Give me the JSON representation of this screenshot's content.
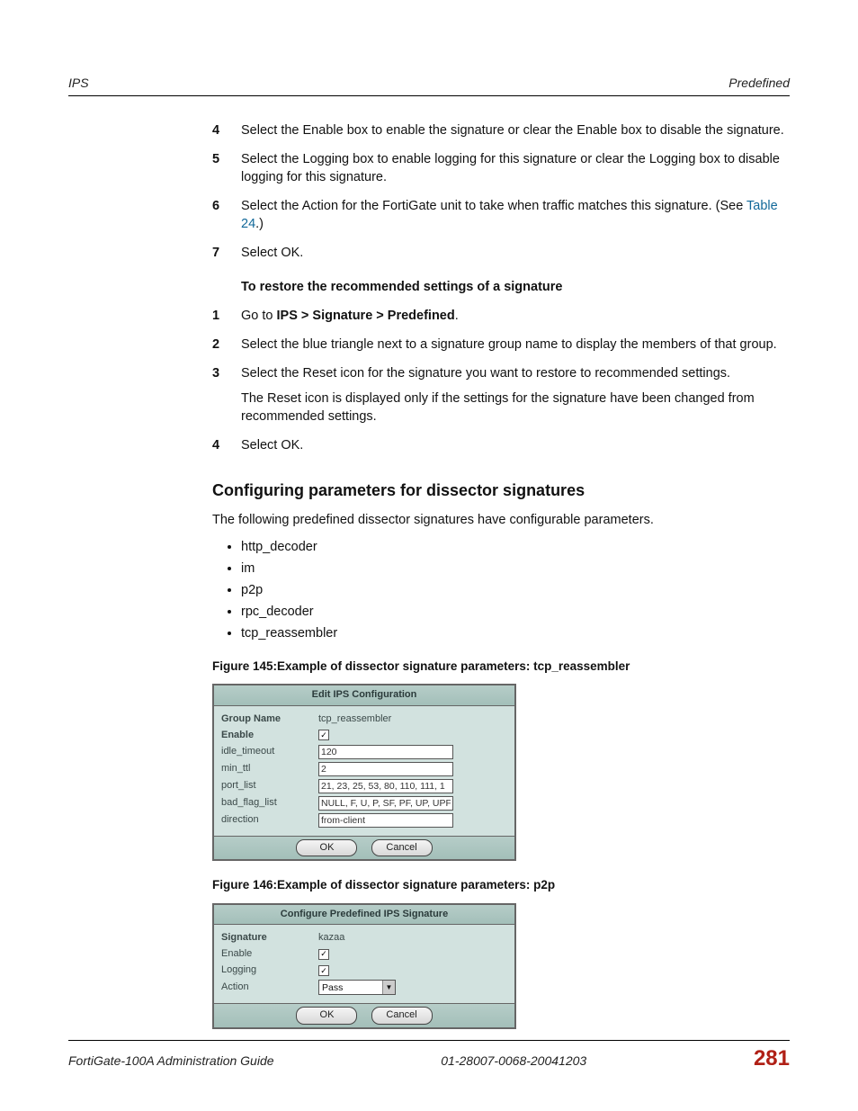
{
  "header": {
    "left": "IPS",
    "right": "Predefined"
  },
  "procedure1": [
    {
      "num": "4",
      "paras": [
        "Select the Enable box to enable the signature or clear the Enable box to disable the signature."
      ]
    },
    {
      "num": "5",
      "paras": [
        "Select the Logging box to enable logging for this signature or clear the Logging box to disable logging for this signature."
      ]
    },
    {
      "num": "6",
      "paras": [
        "Select the Action for the FortiGate unit to take when traffic matches this signature. (See <a class=\"link\" data-name=\"crossref-link\" data-interactable=\"true\">Table 24</a>.)"
      ]
    },
    {
      "num": "7",
      "paras": [
        "Select OK."
      ]
    }
  ],
  "sub_heading": "To restore the recommended settings of a signature",
  "procedure2": [
    {
      "num": "1",
      "paras": [
        "Go to <strong>IPS > Signature > Predefined</strong>."
      ]
    },
    {
      "num": "2",
      "paras": [
        "Select the blue triangle next to a signature group name to display the members of that group."
      ]
    },
    {
      "num": "3",
      "paras": [
        "Select the Reset icon for the signature you want to restore to recommended settings.",
        "The Reset icon is displayed only if the settings for the signature have been changed from recommended settings."
      ]
    },
    {
      "num": "4",
      "paras": [
        "Select OK."
      ]
    }
  ],
  "section_heading": "Configuring parameters for dissector signatures",
  "section_intro": "The following predefined dissector signatures have configurable parameters.",
  "bullets": [
    "http_decoder",
    "im",
    "p2p",
    "rpc_decoder",
    "tcp_reassembler"
  ],
  "fig145": {
    "caption": "Figure 145:Example of dissector signature parameters: tcp_reassembler",
    "title": "Edit IPS Configuration",
    "rows": {
      "group_name_label": "Group Name",
      "group_name_value": "tcp_reassembler",
      "enable_label": "Enable",
      "idle_timeout_label": "idle_timeout",
      "idle_timeout_value": "120",
      "min_ttl_label": "min_ttl",
      "min_ttl_value": "2",
      "port_list_label": "port_list",
      "port_list_value": "21, 23, 25, 53, 80, 110, 111, 1",
      "bad_flag_list_label": "bad_flag_list",
      "bad_flag_list_value": "NULL, F, U, P, SF, PF, UP, UPF, U",
      "direction_label": "direction",
      "direction_value": "from-client"
    },
    "ok": "OK",
    "cancel": "Cancel"
  },
  "fig146": {
    "caption": "Figure 146:Example of dissector signature parameters: p2p",
    "title": "Configure Predefined IPS Signature",
    "rows": {
      "signature_label": "Signature",
      "signature_value": "kazaa",
      "enable_label": "Enable",
      "logging_label": "Logging",
      "action_label": "Action",
      "action_value": "Pass"
    },
    "ok": "OK",
    "cancel": "Cancel"
  },
  "footer": {
    "left": "FortiGate-100A Administration Guide",
    "center": "01-28007-0068-20041203",
    "page": "281"
  }
}
